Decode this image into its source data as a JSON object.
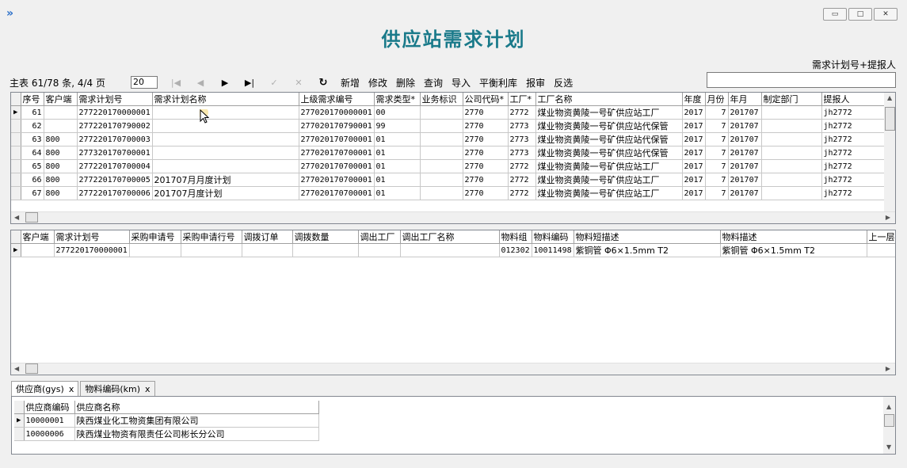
{
  "window": {
    "title": "供应站需求计划",
    "minimize_label": "▭",
    "maximize_label": "□",
    "close_label": "✕"
  },
  "search": {
    "label": "需求计划号+提报人",
    "value": ""
  },
  "toolbar": {
    "page_info": "主表 61/78 条, 4/4 页",
    "page_input": "20",
    "first_icon": "first-page-icon",
    "prev_icon": "prev-icon",
    "next_icon": "next-icon",
    "last_icon": "last-page-icon",
    "confirm_icon": "check-icon",
    "cancel_icon": "x-icon",
    "refresh_icon": "refresh-icon",
    "buttons": [
      "新增",
      "修改",
      "删除",
      "查询",
      "导入",
      "平衡利库",
      "报审",
      "反选"
    ]
  },
  "master": {
    "columns": [
      "序号",
      "客户端",
      "需求计划号",
      "需求计划名称",
      "上级需求编号",
      "需求类型*",
      "业务标识",
      "公司代码*",
      "工厂*",
      "工厂名称",
      "年度",
      "月份",
      "年月",
      "制定部门",
      "提报人"
    ],
    "rows": [
      [
        "61",
        "",
        "277220170000001",
        "",
        "277020170000001",
        "00",
        "",
        "2770",
        "2772",
        "煤业物资黄陵一号矿供应站工厂",
        "2017",
        "7",
        "201707",
        "",
        "jh2772"
      ],
      [
        "62",
        "",
        "277220170790002",
        "",
        "277020170790001",
        "99",
        "",
        "2770",
        "2773",
        "煤业物资黄陵一号矿供应站代保管",
        "2017",
        "7",
        "201707",
        "",
        "jh2772"
      ],
      [
        "63",
        "800",
        "277220170700003",
        "",
        "277020170700001",
        "01",
        "",
        "2770",
        "2773",
        "煤业物资黄陵一号矿供应站代保管",
        "2017",
        "7",
        "201707",
        "",
        "jh2772"
      ],
      [
        "64",
        "800",
        "277320170700001",
        "",
        "277020170700001",
        "01",
        "",
        "2770",
        "2773",
        "煤业物资黄陵一号矿供应站代保管",
        "2017",
        "7",
        "201707",
        "",
        "jh2772"
      ],
      [
        "65",
        "800",
        "277220170700004",
        "",
        "277020170700001",
        "01",
        "",
        "2770",
        "2772",
        "煤业物资黄陵一号矿供应站工厂",
        "2017",
        "7",
        "201707",
        "",
        "jh2772"
      ],
      [
        "66",
        "800",
        "277220170700005",
        "201707月月度计划",
        "277020170700001",
        "01",
        "",
        "2770",
        "2772",
        "煤业物资黄陵一号矿供应站工厂",
        "2017",
        "7",
        "201707",
        "",
        "jh2772"
      ],
      [
        "67",
        "800",
        "277220170700006",
        "201707月度计划",
        "277020170700001",
        "01",
        "",
        "2770",
        "2772",
        "煤业物资黄陵一号矿供应站工厂",
        "2017",
        "7",
        "201707",
        "",
        "jh2772"
      ]
    ]
  },
  "detail": {
    "columns": [
      "客户端",
      "需求计划号",
      "采购申请号",
      "采购申请行号",
      "调拨订单",
      "调拨数量",
      "调出工厂",
      "调出工厂名称",
      "物料组",
      "物料编码",
      "物料短描述",
      "物料描述",
      "上一层"
    ],
    "rows": [
      [
        "",
        "277220170000001",
        "",
        "",
        "",
        "",
        "",
        "",
        "012302",
        "10011498",
        "紫铜管 Φ6×1.5mm T2",
        "紫铜管 Φ6×1.5mm T2",
        ""
      ]
    ]
  },
  "tabs": [
    {
      "label": "供应商(gys)",
      "close": "x"
    },
    {
      "label": "物料编码(km)",
      "close": "x"
    }
  ],
  "supplier": {
    "columns": [
      "供应商编码",
      "供应商名称"
    ],
    "rows": [
      [
        "10000001",
        "陕西煤业化工物资集团有限公司"
      ],
      [
        "10000006",
        "陕西煤业物资有限责任公司彬长分公司"
      ]
    ]
  },
  "colors": {
    "title": "#1a7a8a",
    "grid_border": "#828790",
    "background": "#f0f0f0"
  }
}
